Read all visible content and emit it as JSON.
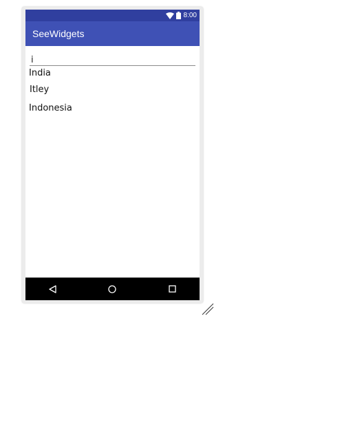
{
  "status_bar": {
    "time": "8:00",
    "icons": [
      "wifi-icon",
      "battery-icon"
    ]
  },
  "app_bar": {
    "title": "SeeWidgets"
  },
  "search": {
    "value": "i"
  },
  "results": [
    {
      "label": "India"
    },
    {
      "label": "Itley"
    },
    {
      "label": "Indonesia"
    }
  ],
  "nav_bar": {
    "icons": [
      "back-icon",
      "home-icon",
      "recents-icon"
    ]
  },
  "colors": {
    "primary": "#3f51b5",
    "primary_dark": "#303f9f",
    "nav_background": "#000000"
  }
}
